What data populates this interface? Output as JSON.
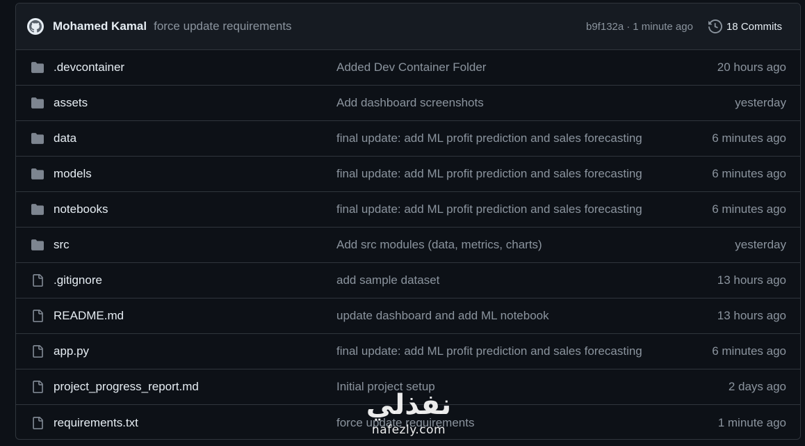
{
  "header": {
    "author": "Mohamed Kamal",
    "message": "force update requirements",
    "commit_hash": "b9f132a",
    "separator": "·",
    "commit_time": "1 minute ago",
    "commits_label": "18 Commits"
  },
  "files": [
    {
      "type": "folder",
      "name": ".devcontainer",
      "message": "Added Dev Container Folder",
      "time": "20 hours ago"
    },
    {
      "type": "folder",
      "name": "assets",
      "message": "Add dashboard screenshots",
      "time": "yesterday"
    },
    {
      "type": "folder",
      "name": "data",
      "message": "final update: add ML profit prediction and sales forecasting",
      "time": "6 minutes ago"
    },
    {
      "type": "folder",
      "name": "models",
      "message": "final update: add ML profit prediction and sales forecasting",
      "time": "6 minutes ago"
    },
    {
      "type": "folder",
      "name": "notebooks",
      "message": "final update: add ML profit prediction and sales forecasting",
      "time": "6 minutes ago"
    },
    {
      "type": "folder",
      "name": "src",
      "message": "Add src modules (data, metrics, charts)",
      "time": "yesterday"
    },
    {
      "type": "file",
      "name": ".gitignore",
      "message": "add sample dataset",
      "time": "13 hours ago"
    },
    {
      "type": "file",
      "name": "README.md",
      "message": "update dashboard and add ML notebook",
      "time": "13 hours ago"
    },
    {
      "type": "file",
      "name": "app.py",
      "message": "final update: add ML profit prediction and sales forecasting",
      "time": "6 minutes ago"
    },
    {
      "type": "file",
      "name": "project_progress_report.md",
      "message": "Initial project setup",
      "time": "2 days ago"
    },
    {
      "type": "file",
      "name": "requirements.txt",
      "message": "force update requirements",
      "time": "1 minute ago"
    }
  ],
  "icons": {
    "folder": "folder-icon",
    "file": "file-icon",
    "history": "history-icon",
    "avatar": "github-avatar-icon"
  },
  "colors": {
    "background": "#0d1117",
    "header_bg": "#161b22",
    "border": "#30363d",
    "text": "#e6edf3",
    "muted": "#8b949e",
    "icon": "#7d8590"
  },
  "watermark": {
    "arabic": "نفذلي",
    "latin": "nafezly.com"
  }
}
